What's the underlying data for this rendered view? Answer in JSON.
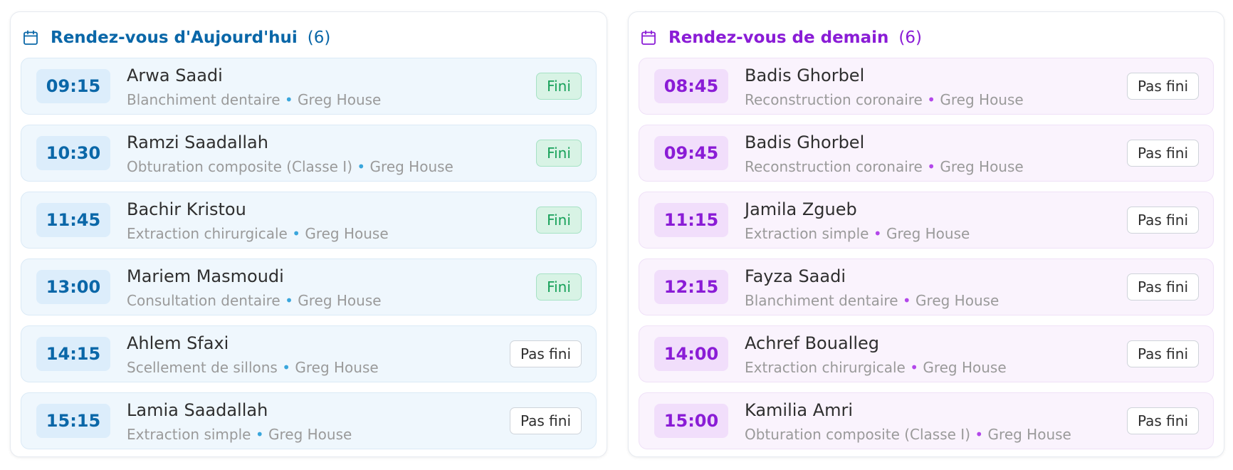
{
  "colors": {
    "today_accent": "#0a67a8",
    "tomorrow_accent": "#8a1cd6",
    "done_text": "#18a15a",
    "done_bg": "#d8f3e5"
  },
  "today": {
    "icon": "calendar-icon",
    "title": "Rendez-vous d'Aujourd'hui",
    "count": "(6)",
    "appointments": [
      {
        "time": "09:15",
        "patient": "Arwa Saadi",
        "treatment": "Blanchiment dentaire",
        "separator": "•",
        "doctor": "Greg House",
        "status": "Fini"
      },
      {
        "time": "10:30",
        "patient": "Ramzi Saadallah",
        "treatment": "Obturation composite (Classe I)",
        "separator": "•",
        "doctor": "Greg House",
        "status": "Fini"
      },
      {
        "time": "11:45",
        "patient": "Bachir Kristou",
        "treatment": "Extraction chirurgicale",
        "separator": "•",
        "doctor": "Greg House",
        "status": "Fini"
      },
      {
        "time": "13:00",
        "patient": "Mariem Masmoudi",
        "treatment": "Consultation dentaire",
        "separator": "•",
        "doctor": "Greg House",
        "status": "Fini"
      },
      {
        "time": "14:15",
        "patient": "Ahlem Sfaxi",
        "treatment": "Scellement de sillons",
        "separator": "•",
        "doctor": "Greg House",
        "status": "Pas fini"
      },
      {
        "time": "15:15",
        "patient": "Lamia Saadallah",
        "treatment": "Extraction simple",
        "separator": "•",
        "doctor": "Greg House",
        "status": "Pas fini"
      }
    ]
  },
  "tomorrow": {
    "icon": "calendar-icon",
    "title": "Rendez-vous de demain",
    "count": "(6)",
    "appointments": [
      {
        "time": "08:45",
        "patient": "Badis Ghorbel",
        "treatment": "Reconstruction coronaire",
        "separator": "•",
        "doctor": "Greg House",
        "status": "Pas fini"
      },
      {
        "time": "09:45",
        "patient": "Badis Ghorbel",
        "treatment": "Reconstruction coronaire",
        "separator": "•",
        "doctor": "Greg House",
        "status": "Pas fini"
      },
      {
        "time": "11:15",
        "patient": "Jamila Zgueb",
        "treatment": "Extraction simple",
        "separator": "•",
        "doctor": "Greg House",
        "status": "Pas fini"
      },
      {
        "time": "12:15",
        "patient": "Fayza Saadi",
        "treatment": "Blanchiment dentaire",
        "separator": "•",
        "doctor": "Greg House",
        "status": "Pas fini"
      },
      {
        "time": "14:00",
        "patient": "Achref Boualleg",
        "treatment": "Extraction chirurgicale",
        "separator": "•",
        "doctor": "Greg House",
        "status": "Pas fini"
      },
      {
        "time": "15:00",
        "patient": "Kamilia Amri",
        "treatment": "Obturation composite (Classe I)",
        "separator": "•",
        "doctor": "Greg House",
        "status": "Pas fini"
      }
    ]
  }
}
